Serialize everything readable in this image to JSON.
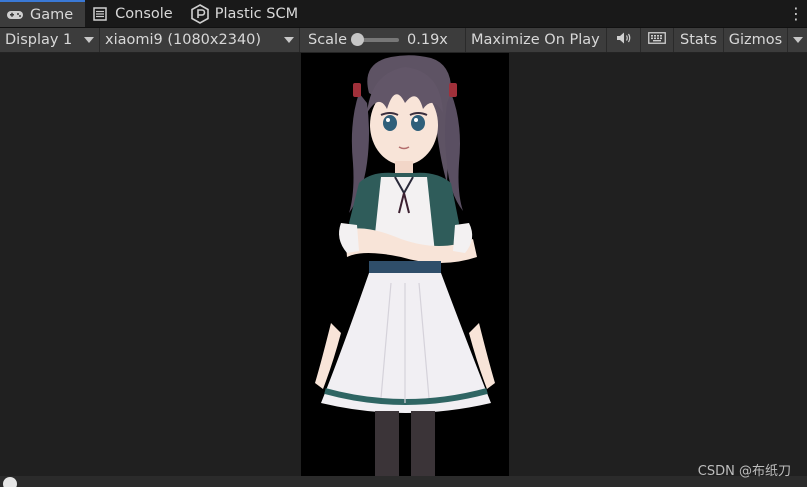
{
  "tabs": [
    {
      "label": "Game",
      "icon": "gamepad-icon",
      "active": true
    },
    {
      "label": "Console",
      "icon": "console-icon",
      "active": false
    },
    {
      "label": "Plastic SCM",
      "icon": "plastic-scm-icon",
      "active": false
    }
  ],
  "toolbar": {
    "display": "Display 1",
    "resolution": "xiaomi9 (1080x2340)",
    "scale_label": "Scale",
    "scale_value": "0.19x",
    "maximize": "Maximize On Play",
    "stats": "Stats",
    "gizmos": "Gizmos"
  },
  "watermark": "CSDN @布纸刀",
  "colors": {
    "tab_accent": "#3a79d6",
    "toolbar_bg": "#3c3c3c",
    "view_bg": "#202020",
    "device_bg": "#000000"
  }
}
